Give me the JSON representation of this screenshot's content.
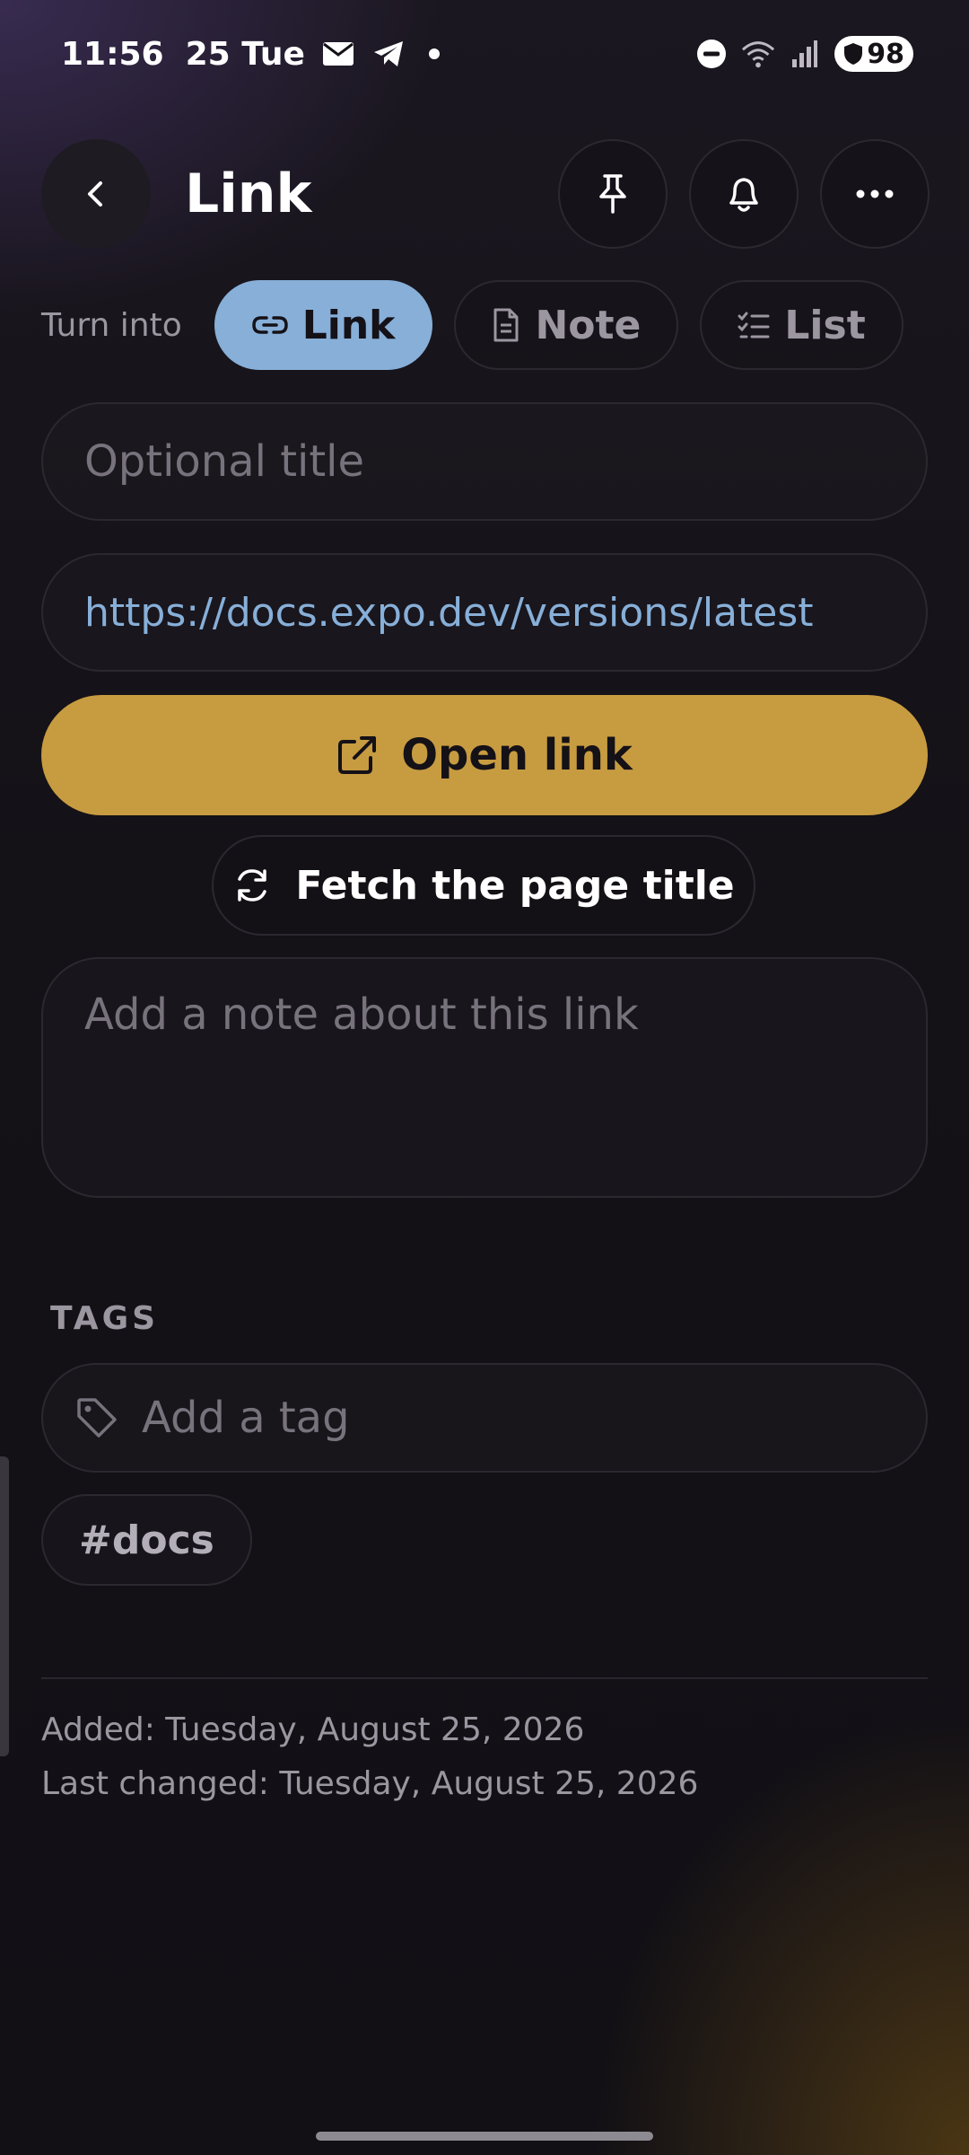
{
  "status_bar": {
    "time": "11:56",
    "date": "25 Tue",
    "battery": "98"
  },
  "header": {
    "title": "Link",
    "icons": [
      "back-icon",
      "pin-icon",
      "bell-icon",
      "more-icon"
    ]
  },
  "turn_into": {
    "label": "Turn into",
    "options": [
      {
        "label": "Link",
        "icon": "link-icon",
        "active": true
      },
      {
        "label": "Note",
        "icon": "note-icon",
        "active": false
      },
      {
        "label": "List",
        "icon": "checklist-icon",
        "active": false
      }
    ]
  },
  "form": {
    "title_placeholder": "Optional title",
    "url_value": "https://docs.expo.dev/versions/latest",
    "open_link_label": "Open link",
    "fetch_title_label": "Fetch the page title",
    "note_placeholder": "Add a note about this link"
  },
  "tags": {
    "heading": "TAGS",
    "input_placeholder": "Add a tag",
    "items": [
      "#docs"
    ]
  },
  "meta": {
    "added": "Added: Tuesday, August 25, 2026",
    "last_changed": "Last changed: Tuesday, August 25, 2026"
  },
  "colors": {
    "accent_blue": "#87afd8",
    "accent_gold": "#c79b40",
    "background": "#141117"
  }
}
